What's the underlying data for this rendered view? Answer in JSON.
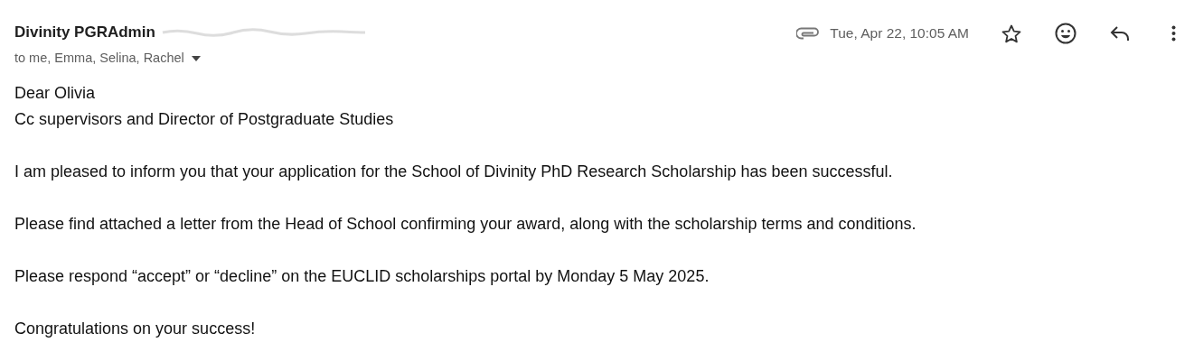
{
  "sender": {
    "name": "Divinity PGRAdmin",
    "address_redacted": true
  },
  "recipients": "to me, Emma, Selina, Rachel",
  "has_attachment": true,
  "date": "Tue, Apr 22, 10:05 AM",
  "starred": false,
  "body": [
    [
      "Dear Olivia",
      "Cc supervisors and Director of Postgraduate Studies"
    ],
    [
      "I am pleased to inform you that your application for the School of Divinity PhD Research Scholarship has been successful."
    ],
    [
      "Please find attached a letter from the Head of School confirming your award, along with the scholarship terms and conditions."
    ],
    [
      "Please respond “accept” or “decline” on the EUCLID scholarships portal by Monday 5 May 2025."
    ],
    [
      "Congratulations on your success!"
    ]
  ]
}
